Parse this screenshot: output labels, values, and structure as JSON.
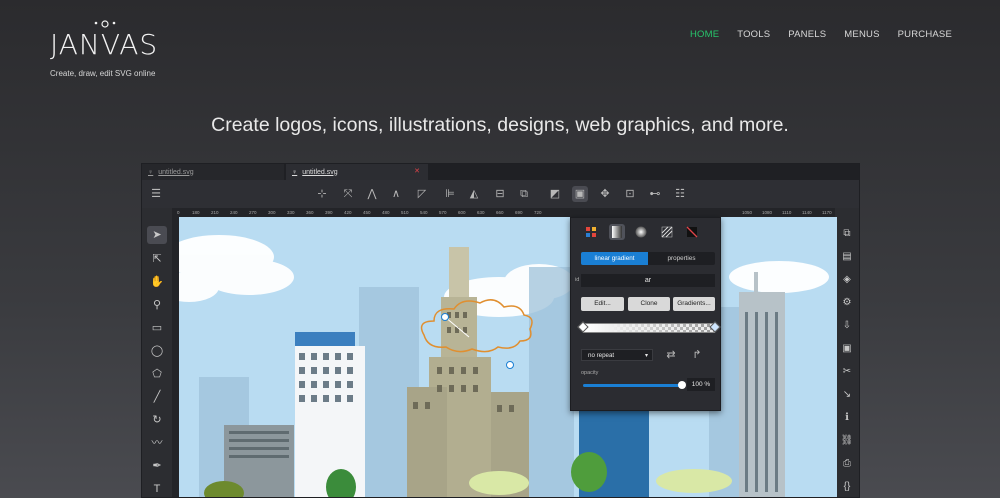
{
  "brand": {
    "name": "JANVAS",
    "tagline": "Create, draw, edit SVG online"
  },
  "nav": [
    {
      "label": "HOME",
      "active": true
    },
    {
      "label": "TOOLS",
      "active": false
    },
    {
      "label": "PANELS",
      "active": false
    },
    {
      "label": "MENUS",
      "active": false
    },
    {
      "label": "PURCHASE",
      "active": false
    }
  ],
  "headline": "Create logos, icons, illustrations, designs, web graphics, and more.",
  "editor": {
    "tabs": [
      {
        "label": "untitled.svg"
      },
      {
        "label": "untitled.svg",
        "active": true
      }
    ],
    "ruler_marks": [
      "0",
      "180",
      "210",
      "240",
      "270",
      "300",
      "330",
      "360",
      "390",
      "420",
      "450",
      "480",
      "510",
      "540",
      "570",
      "600",
      "630",
      "660",
      "690",
      "720",
      "1050",
      "1080",
      "1110",
      "1140",
      "1170"
    ],
    "fill_panel": {
      "segments": {
        "active": "linear gradient",
        "inactive": "properties"
      },
      "id_label": "id",
      "id_value": "ar",
      "buttons": [
        "Edit...",
        "Clone",
        "Gradients..."
      ],
      "spread_select": "no repeat",
      "opacity_label": "opacity",
      "opacity_value": "100 %",
      "opacity_fraction": 1.0
    },
    "colors": {
      "accent": "#1a7fd4",
      "nav_active": "#27c46b",
      "close_tab": "#e0444a",
      "sky": "#b9dcf2"
    }
  }
}
